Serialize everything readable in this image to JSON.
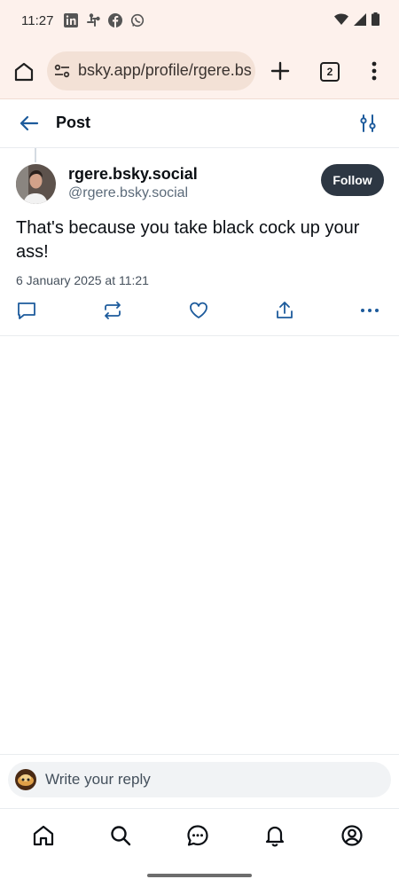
{
  "status_bar": {
    "time": "11:27",
    "notification_icons": [
      "linkedin-icon",
      "slack-icon",
      "facebook-icon",
      "whatsapp-icon"
    ],
    "system_icons": [
      "wifi-icon",
      "signal-icon",
      "battery-icon"
    ]
  },
  "browser": {
    "url": "bsky.app/profile/rgere.bs",
    "tab_count": "2"
  },
  "header": {
    "title": "Post"
  },
  "post": {
    "display_name": "rgere.bsky.social",
    "handle": "@rgere.bsky.social",
    "follow_label": "Follow",
    "text": "That's because you take black cock up your ass!",
    "date": "6 January 2025 at 11:21"
  },
  "reply": {
    "placeholder": "Write your reply"
  },
  "colors": {
    "accent": "#1d5b9c",
    "browser_bg": "#fdf1ec",
    "follow_bg": "#2d3743",
    "muted_text": "#5c6b7a"
  }
}
